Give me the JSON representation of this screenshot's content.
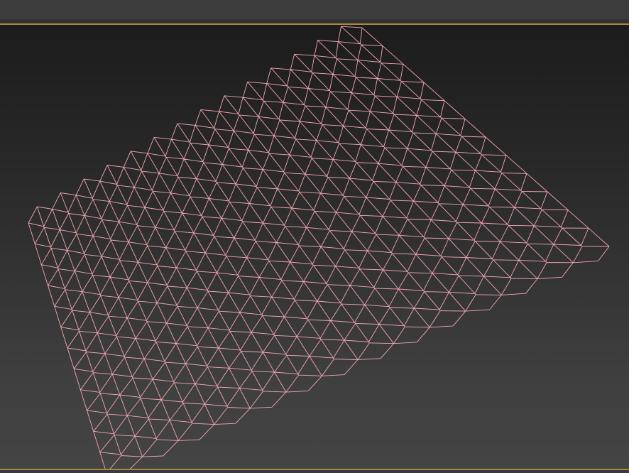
{
  "viewport": {
    "border_color": "#a88a3c",
    "wireframe_color": "#f2a7b0",
    "background_top": "#1c1c1c",
    "background_bottom": "#444444"
  },
  "mesh": {
    "type": "diamond-lattice",
    "selected": false
  }
}
